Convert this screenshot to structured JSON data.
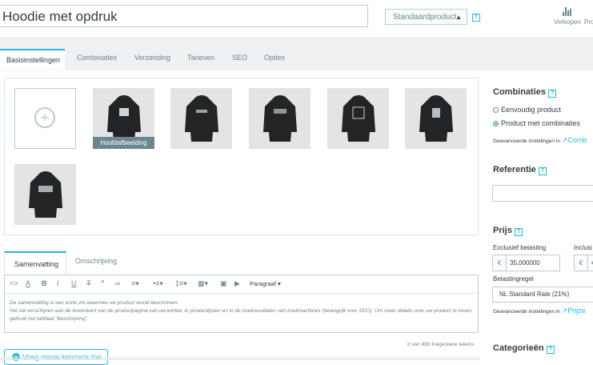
{
  "product": {
    "name": "Hoodie met opdruk",
    "type": "Standaardproduct"
  },
  "header": {
    "sales": "Verkopen",
    "pro": "Pro"
  },
  "tabs": [
    "Basisinstellingen",
    "Combinaties",
    "Verzending",
    "Tarieven",
    "SEO",
    "Opties"
  ],
  "images": {
    "cover_label": "Hoofdafbeelding"
  },
  "summary": {
    "tabs": [
      "Samenvatting",
      "Omschrijving"
    ],
    "paragraph_label": "Paragraaf",
    "help_line1": "De samenvatting is een korte zin waarmee uw product wordt beschreven.",
    "help_line2": "Het zal verschijnen aan de bovenkant van de productpagina van uw winkel, in productlijsten en in de zoekresultaten van zoekmachines (belangrijk voor SEO). Om meer details over uw product te tonen, gebruik het tabblad \"Beschrijving\".",
    "counter": "0 van 800 toegestane tekens"
  },
  "add_feature": "Voeg nieuw kenmerk toe",
  "right": {
    "combinations_title": "Combinaties",
    "simple_product": "Eenvoudig product",
    "with_combinations": "Product met combinaties",
    "advanced_text": "Geavanceerde instellingen in",
    "advanced_link_comb": "Comb",
    "reference_title": "Referentie",
    "price_title": "Prijs",
    "excl_tax": "Exclusief belasting",
    "incl_tax": "Inclusi",
    "currency": "€",
    "price_value": "35,000000",
    "price_incl_value": "4",
    "tax_rule_label": "Belastingregel",
    "tax_rule_value": "NL Standard Rate (21%)",
    "advanced_link_price": "Prijze",
    "categories_title": "Categorieën"
  },
  "icons": [
    "stats-icon",
    "plus-circle-icon",
    "external-link-icon",
    "help-icon"
  ]
}
